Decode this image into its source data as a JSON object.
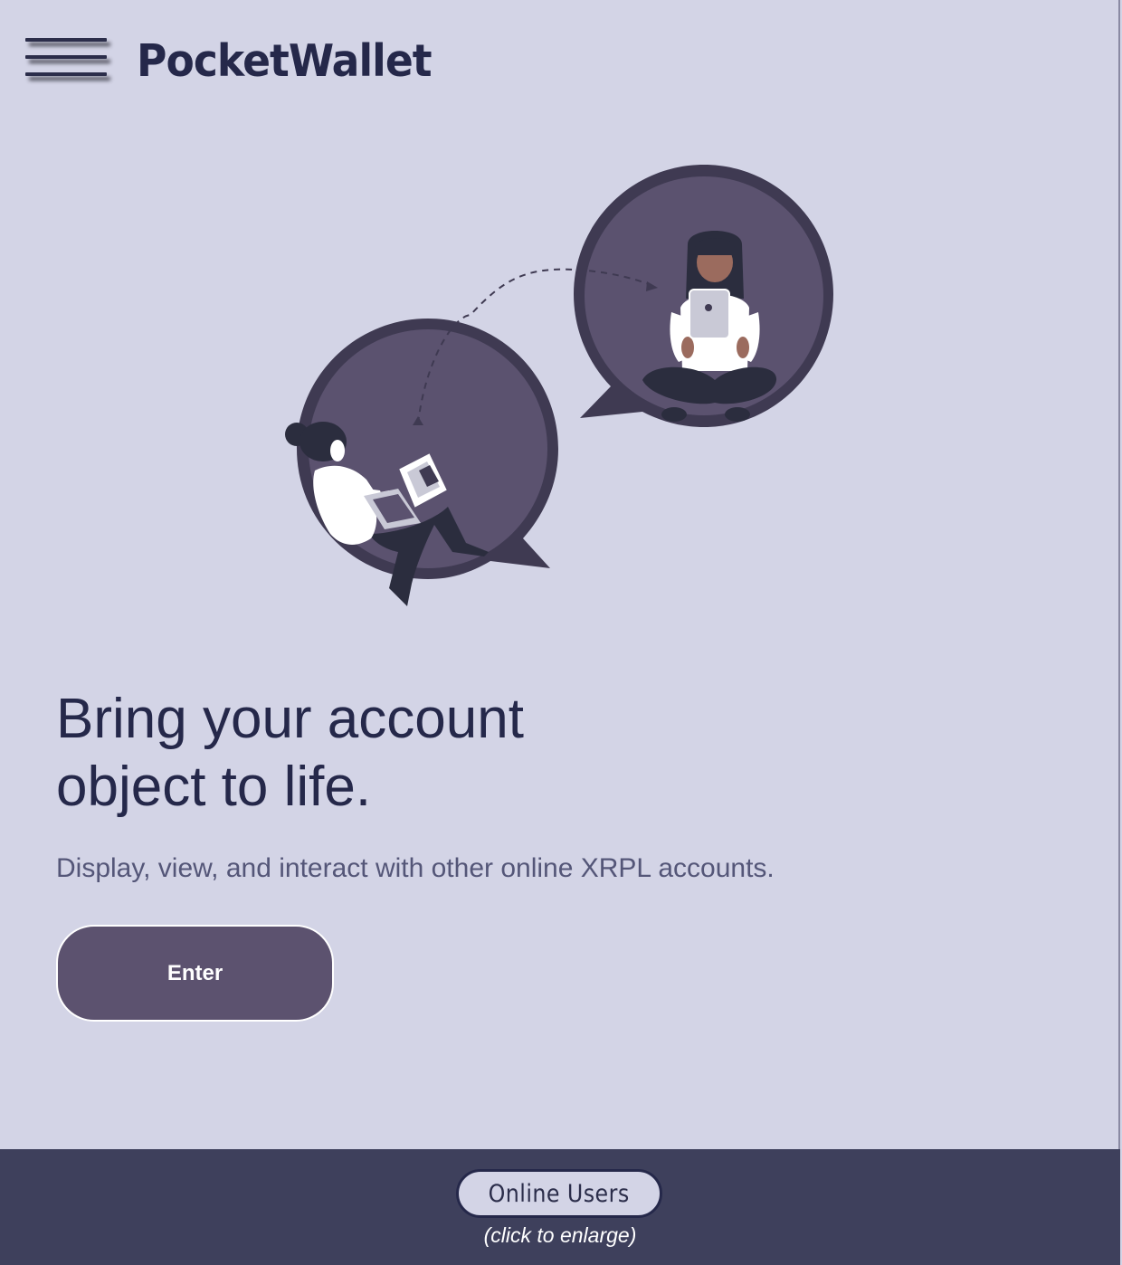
{
  "header": {
    "brand": "PocketWallet",
    "menu_icon": "hamburger-menu-icon"
  },
  "hero": {
    "illustration_icon": "chat-bubbles-people-illustration",
    "title_line1": "Bring your account",
    "title_line2": "object to life.",
    "subtitle": "Display, view, and interact with other online XRPL accounts.",
    "enter_label": "Enter"
  },
  "footer": {
    "online_users_label": "Online Users",
    "hint": "(click to enlarge)"
  },
  "colors": {
    "background": "#d3d4e6",
    "brand_text": "#25284a",
    "accent_purple": "#5c526f",
    "footer_bg": "#3e405c"
  }
}
